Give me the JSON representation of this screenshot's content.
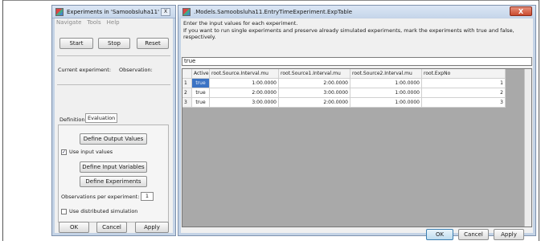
{
  "left_window": {
    "title": "Experiments in  'Samoobsluha11'",
    "menu": [
      "Navigate",
      "Tools",
      "Help"
    ],
    "start": "Start",
    "stop": "Stop",
    "reset": "Reset",
    "current_experiment": "Current experiment:",
    "observation": "Observation:",
    "tabs": [
      "Definition",
      "Evaluation"
    ],
    "define_output": "Define Output Values",
    "use_input": "Use input values",
    "use_input_checked": true,
    "define_input": "Define Input Variables",
    "define_experiments": "Define Experiments",
    "obs_label": "Observations per experiment:",
    "obs_value": "1",
    "distributed": "Use distributed simulation",
    "distributed_checked": false,
    "ok": "OK",
    "cancel": "Cancel",
    "apply": "Apply",
    "close": "X"
  },
  "right_window": {
    "title": ".Models.Samoobsluha11.EntryTimeExperiment.ExpTable",
    "close": "X",
    "instructions_line1": "Enter the input values for each experiment.",
    "instructions_line2": "If you want to run single experiments and preserve already simulated experiments, mark the experiments with true and false, respectively.",
    "edit_value": "true",
    "columns": [
      "Active",
      "root.Source.Interval.mu",
      "root.Source1.Interval.mu",
      "root.Source2.Interval.mu",
      "root.ExpNo"
    ],
    "rows": [
      {
        "n": "1",
        "active": "true",
        "c1": "1:00.0000",
        "c2": "2:00.0000",
        "c3": "1:00.0000",
        "c4": "1"
      },
      {
        "n": "2",
        "active": "true",
        "c1": "2:00.0000",
        "c2": "3:00.0000",
        "c3": "1:00.0000",
        "c4": "2"
      },
      {
        "n": "3",
        "active": "true",
        "c1": "3:00.0000",
        "c2": "2:00.0000",
        "c3": "1:00.0000",
        "c4": "3"
      }
    ],
    "ok": "OK",
    "cancel": "Cancel",
    "apply": "Apply"
  },
  "colors": {
    "title_bar": "#c6d6ea",
    "selection": "#3b73c4",
    "close_button": "#c94a2e"
  }
}
